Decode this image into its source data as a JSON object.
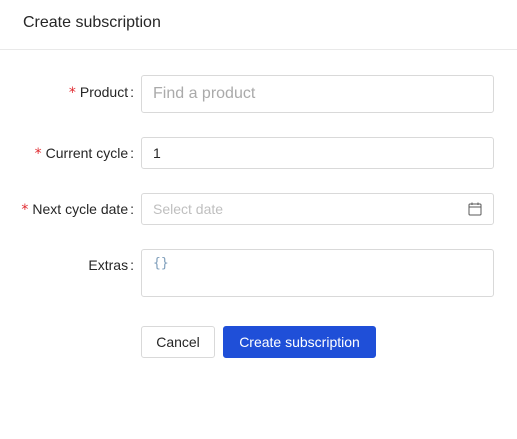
{
  "dialog": {
    "title": "Create subscription"
  },
  "form": {
    "product": {
      "label": "Product",
      "required_mark": "*",
      "colon": ":",
      "value": "",
      "placeholder": "Find a product"
    },
    "current_cycle": {
      "label": "Current cycle",
      "required_mark": "*",
      "colon": ":",
      "value": "1"
    },
    "next_cycle_date": {
      "label": "Next cycle date",
      "required_mark": "*",
      "colon": ":",
      "value": "",
      "placeholder": "Select date",
      "icon": "calendar-icon"
    },
    "extras": {
      "label": "Extras",
      "colon": ":",
      "value": "{}"
    }
  },
  "actions": {
    "cancel_label": "Cancel",
    "submit_label": "Create subscription"
  },
  "colors": {
    "primary": "#1f4fd8",
    "required": "#e0282e",
    "border": "#d9d9d9"
  }
}
